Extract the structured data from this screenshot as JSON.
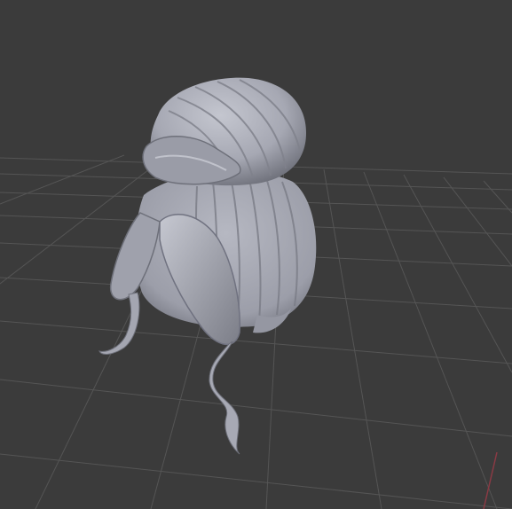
{
  "viewport": {
    "background_color": "#3b3b3b",
    "grid_color": "#555555",
    "axis_x_color": "#8a3a44",
    "model_color": "#a6a8b3",
    "model_shadow_color": "#6c6e78",
    "model_highlight_color": "#c4c6cf",
    "grid_visible": true,
    "model_name": ""
  }
}
